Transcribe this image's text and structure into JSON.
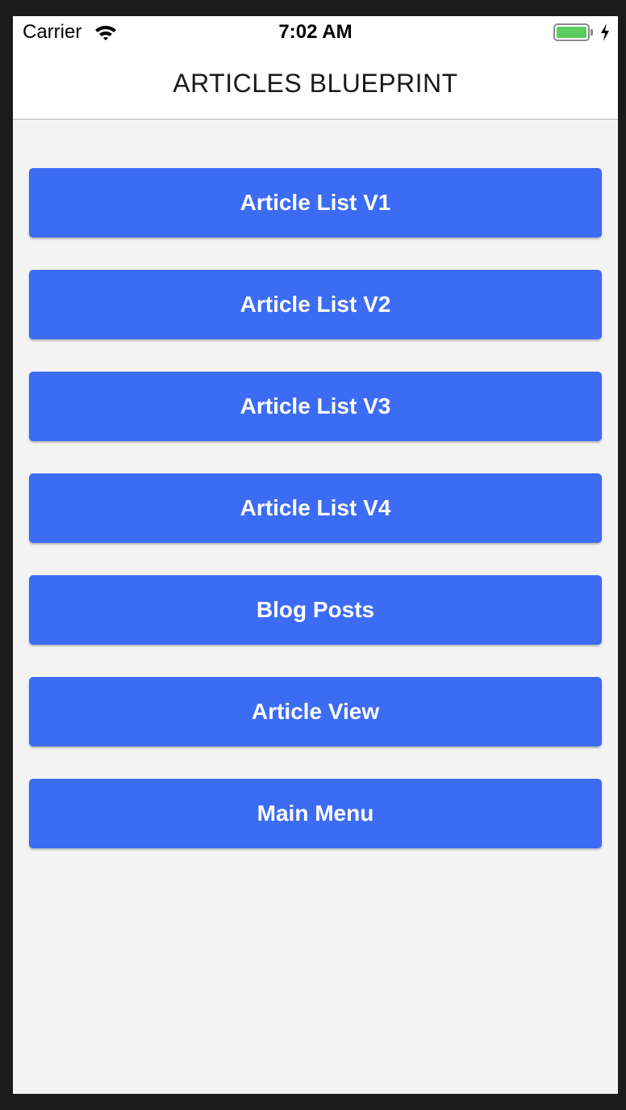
{
  "status_bar": {
    "carrier": "Carrier",
    "time": "7:02 AM",
    "icons": [
      "wifi-icon",
      "battery-icon",
      "charging-bolt-icon"
    ],
    "battery_color": "#5ccc5c"
  },
  "nav": {
    "title": "ARTICLES BLUEPRINT"
  },
  "menu": {
    "button_color": "#3c6cf4",
    "items": [
      {
        "label": "Article List V1"
      },
      {
        "label": "Article List V2"
      },
      {
        "label": "Article List V3"
      },
      {
        "label": "Article List V4"
      },
      {
        "label": "Blog Posts"
      },
      {
        "label": "Article View"
      },
      {
        "label": "Main Menu"
      }
    ]
  }
}
